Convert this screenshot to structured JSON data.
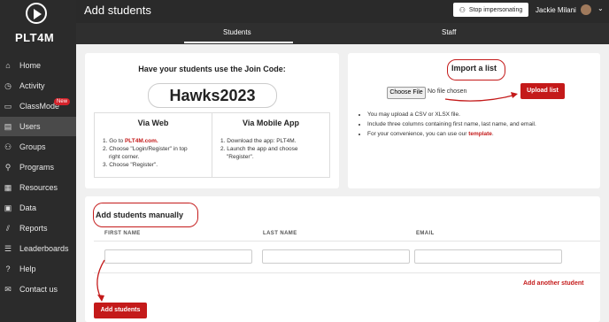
{
  "app": {
    "logo_text": "PLT4M"
  },
  "sidebar": {
    "items": [
      {
        "label": "Home",
        "icon": "home-icon",
        "glyph": "⌂"
      },
      {
        "label": "Activity",
        "icon": "activity-icon",
        "glyph": "◷"
      },
      {
        "label": "ClassMode",
        "icon": "classmode-icon",
        "glyph": "▭",
        "badge": "New"
      },
      {
        "label": "Users",
        "icon": "users-icon",
        "glyph": "▤"
      },
      {
        "label": "Groups",
        "icon": "groups-icon",
        "glyph": "⚇"
      },
      {
        "label": "Programs",
        "icon": "programs-icon",
        "glyph": "⚲"
      },
      {
        "label": "Resources",
        "icon": "resources-icon",
        "glyph": "▦"
      },
      {
        "label": "Data",
        "icon": "data-icon",
        "glyph": "▣"
      },
      {
        "label": "Reports",
        "icon": "reports-icon",
        "glyph": "⫽"
      },
      {
        "label": "Leaderboards",
        "icon": "leaderboards-icon",
        "glyph": "☰"
      },
      {
        "label": "Help",
        "icon": "help-icon",
        "glyph": "?"
      },
      {
        "label": "Contact us",
        "icon": "mail-icon",
        "glyph": "✉"
      }
    ]
  },
  "header": {
    "title": "Add students",
    "impersonate_label": "Stop impersonating",
    "user_name": "Jackie Milani"
  },
  "tabs": [
    {
      "label": "Students"
    },
    {
      "label": "Staff"
    }
  ],
  "join": {
    "title": "Have your students use the Join Code:",
    "code": "Hawks2023",
    "web": {
      "title": "Via Web",
      "step1_prefix": "1. Go to ",
      "step1_link": "PLT4M.com.",
      "step2": "2. Choose \"Login/Register\" in top",
      "step2b": "right corner.",
      "step3": "3. Choose \"Register\"."
    },
    "app": {
      "title": "Via Mobile App",
      "step1": "1. Download the app: PLT4M.",
      "step2": "2. Launch the app and choose",
      "step2b": "\"Register\"."
    }
  },
  "import": {
    "title": "Import a list",
    "choose_label": "Choose File",
    "no_file": "No file chosen",
    "upload_label": "Upload list",
    "bullet1": "You may upload a CSV or XLSX file.",
    "bullet2": "Include three columns containing first name, last name, and email.",
    "bullet3_prefix": "For your convenience, you can use our ",
    "bullet3_link": "template",
    "bullet3_suffix": "."
  },
  "manual": {
    "title": "Add students manually",
    "col_first": "FIRST NAME",
    "col_last": "LAST NAME",
    "col_email": "EMAIL",
    "add_another": "Add another student",
    "add_button": "Add students"
  },
  "colors": {
    "accent": "#c41a1a",
    "sidebar": "#2b2b2b",
    "content_bg": "#f0f0f0"
  }
}
